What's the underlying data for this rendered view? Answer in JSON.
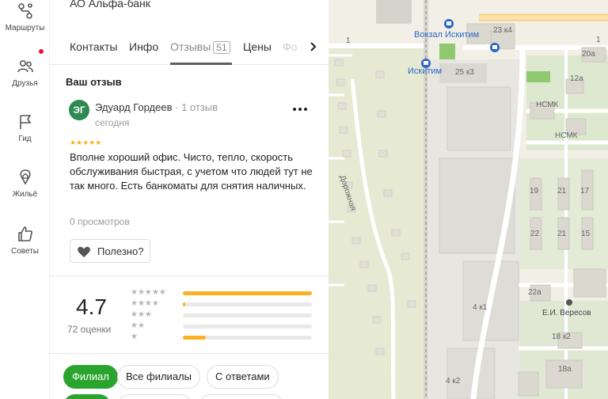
{
  "sidebar": {
    "items": [
      {
        "label": "Маршруты",
        "icon": "route-icon"
      },
      {
        "label": "Друзья",
        "icon": "friends-icon"
      },
      {
        "label": "Гид",
        "icon": "flag-icon"
      },
      {
        "label": "Жильё",
        "icon": "home-icon"
      },
      {
        "label": "Советы",
        "icon": "thumbs-up-icon"
      }
    ]
  },
  "org": {
    "title": "АО Альфа-банк"
  },
  "tabs": [
    {
      "label": "Контакты"
    },
    {
      "label": "Инфо"
    },
    {
      "label": "Отзывы",
      "count": "51"
    },
    {
      "label": "Цены"
    },
    {
      "label": "Фо"
    }
  ],
  "review": {
    "section_title": "Ваш отзыв",
    "avatar_initials": "ЭГ",
    "author": "Эдуард Гордеев",
    "author_meta": "· 1 отзыв",
    "date": "сегодня",
    "stars": "★★★★★",
    "rating": 5,
    "text": "Вполне хороший офис. Чисто, тепло, скорость обслуживания быстрая, с учетом что людей тут не так много. Есть банкоматы для снятия наличных.",
    "views": "0 просмотров",
    "useful_label": "Полезно?"
  },
  "rating_summary": {
    "value": "4.7",
    "count": "72 оценки",
    "rows": [
      {
        "stars": "★★★★★",
        "fraction": 1.0
      },
      {
        "stars": "★★★★",
        "fraction": 0.02
      },
      {
        "stars": "★★★",
        "fraction": 0.0
      },
      {
        "stars": "★★",
        "fraction": 0.0
      },
      {
        "stars": "★",
        "fraction": 0.18
      }
    ]
  },
  "filters": [
    {
      "label": "Филиал",
      "active": true
    },
    {
      "label": "Все филиалы",
      "active": false
    },
    {
      "label": "С ответами",
      "active": false
    }
  ],
  "map": {
    "labels": [
      {
        "text": "Вокзал Искитим",
        "kind": "blue"
      },
      {
        "text": "Искитим",
        "kind": "blue"
      },
      {
        "text": "25 к3",
        "kind": "plain"
      },
      {
        "text": "23 к4",
        "kind": "plain"
      },
      {
        "text": "20а",
        "kind": "plain"
      },
      {
        "text": "12а",
        "kind": "plain"
      },
      {
        "text": "НСМК",
        "kind": "plain"
      },
      {
        "text": "НСМК",
        "kind": "plain"
      },
      {
        "text": "Дорожная",
        "kind": "plain"
      },
      {
        "text": "19",
        "kind": "plain"
      },
      {
        "text": "21",
        "kind": "plain"
      },
      {
        "text": "17",
        "kind": "plain"
      },
      {
        "text": "22",
        "kind": "plain"
      },
      {
        "text": "21",
        "kind": "plain"
      },
      {
        "text": "15",
        "kind": "plain"
      },
      {
        "text": "22а",
        "kind": "plain"
      },
      {
        "text": "4 к1",
        "kind": "plain"
      },
      {
        "text": "Е.И. Вересов",
        "kind": "dark"
      },
      {
        "text": "18 к2",
        "kind": "plain"
      },
      {
        "text": "18а",
        "kind": "plain"
      },
      {
        "text": "4 к2",
        "kind": "plain"
      },
      {
        "text": "1",
        "kind": "plain"
      },
      {
        "text": "1",
        "kind": "plain"
      }
    ]
  },
  "colors": {
    "accent_green": "#2ba42f",
    "star_yellow": "#fcb123",
    "avatar_green": "#2e8a52",
    "notification_red": "#e8172c"
  }
}
